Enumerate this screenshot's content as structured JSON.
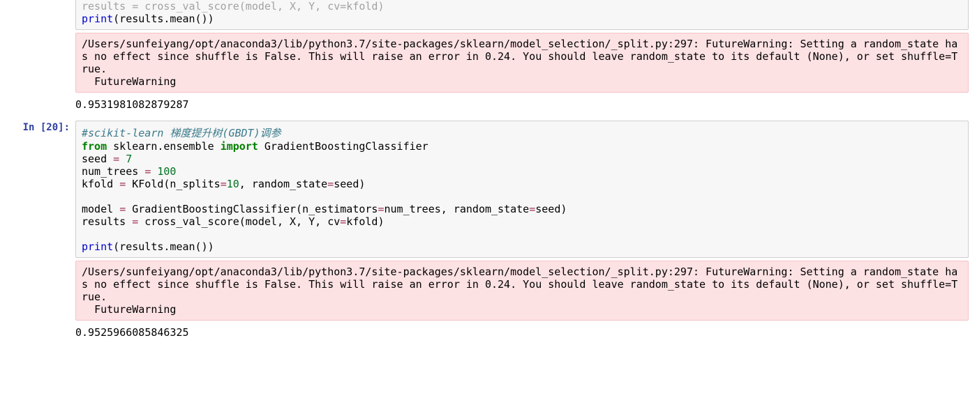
{
  "cell0": {
    "code_cut_line1": "results = cross_val_score(model, X, Y, cv=kfold)",
    "code_line2_fn": "print",
    "code_line2_rest": "(results.mean())",
    "warning": "/Users/sunfeiyang/opt/anaconda3/lib/python3.7/site-packages/sklearn/model_selection/_split.py:297: FutureWarning: Setting a random_state has no effect since shuffle is False. This will raise an error in 0.24. You should leave random_state to its default (None), or set shuffle=True.\n  FutureWarning",
    "output": "0.9531981082879287"
  },
  "cell20": {
    "prompt": "In [20]:",
    "comment": "#scikit-learn 梯度提升树(GBDT)调参",
    "l2_from": "from",
    "l2_mod": " sklearn.ensemble ",
    "l2_import": "import",
    "l2_cls": " GradientBoostingClassifier",
    "l3_a": "seed ",
    "l3_eq": "=",
    "l3_b": " ",
    "l3_num": "7",
    "l4_a": "num_trees ",
    "l4_eq": "=",
    "l4_b": " ",
    "l4_num": "100",
    "l5_a": "kfold ",
    "l5_eq": "=",
    "l5_b": " KFold(n_splits",
    "l5_eq2": "=",
    "l5_num": "10",
    "l5_c": ", random_state",
    "l5_eq3": "=",
    "l5_d": "seed)",
    "l7_a": "model ",
    "l7_eq": "=",
    "l7_b": " GradientBoostingClassifier(n_estimators",
    "l7_eq2": "=",
    "l7_c": "num_trees, random_state",
    "l7_eq3": "=",
    "l7_d": "seed)",
    "l8_a": "results ",
    "l8_eq": "=",
    "l8_b": " cross_val_score(model, X, Y, cv",
    "l8_eq2": "=",
    "l8_c": "kfold)",
    "l10_fn": "print",
    "l10_rest": "(results.mean())",
    "warning": "/Users/sunfeiyang/opt/anaconda3/lib/python3.7/site-packages/sklearn/model_selection/_split.py:297: FutureWarning: Setting a random_state has no effect since shuffle is False. This will raise an error in 0.24. You should leave random_state to its default (None), or set shuffle=True.\n  FutureWarning",
    "output": "0.9525966085846325"
  }
}
